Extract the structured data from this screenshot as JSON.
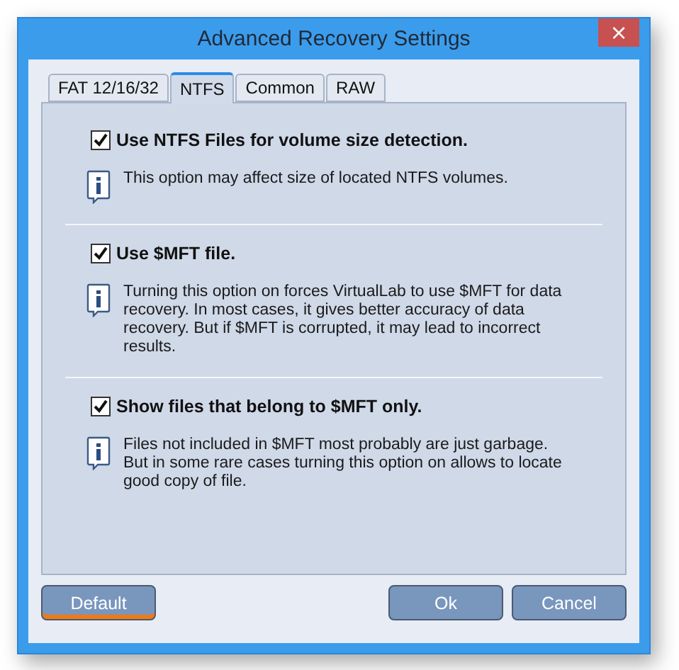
{
  "window": {
    "title": "Advanced Recovery Settings",
    "close": "×"
  },
  "tabs": [
    {
      "label": "FAT 12/16/32",
      "selected": false
    },
    {
      "label": "NTFS",
      "selected": true
    },
    {
      "label": "Common",
      "selected": false
    },
    {
      "label": "RAW",
      "selected": false
    }
  ],
  "options": [
    {
      "label": "Use NTFS Files for volume size detection.",
      "checked": true,
      "info": "This option may affect size of located NTFS volumes."
    },
    {
      "label": "Use $MFT file.",
      "checked": true,
      "info": "Turning this option on forces VirtualLab to use $MFT for data recovery. In most cases, it gives better accuracy of data recovery. But if $MFT is corrupted, it may lead to incorrect results."
    },
    {
      "label": "Show files that belong to $MFT only.",
      "checked": true,
      "info": "Files not included in $MFT most probably are just garbage. But in some rare cases turning this option on allows to locate good copy of file."
    }
  ],
  "buttons": [
    {
      "label": "Default",
      "focused": true
    },
    {
      "label": "Ok",
      "focused": false
    },
    {
      "label": "Cancel",
      "focused": false
    }
  ]
}
